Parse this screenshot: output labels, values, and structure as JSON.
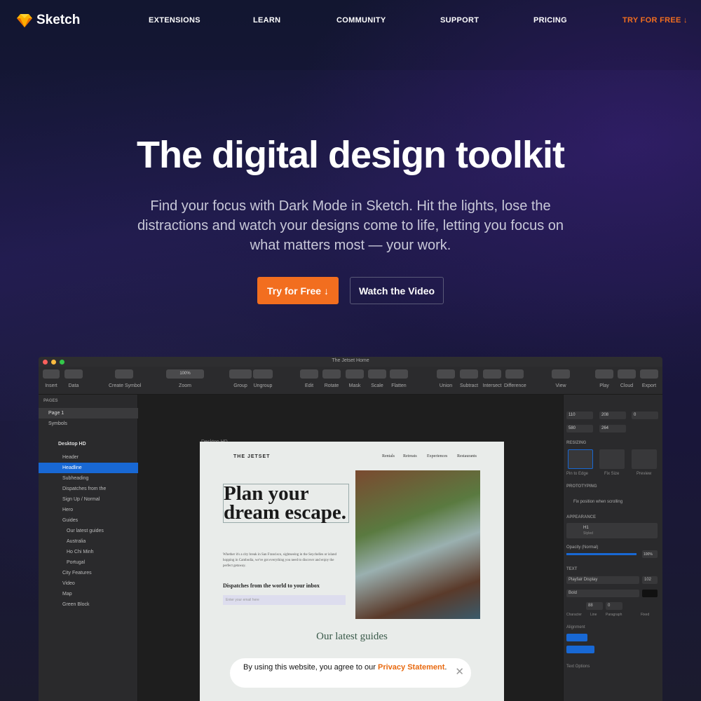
{
  "brand": {
    "name": "Sketch",
    "accent": "#f26e1f"
  },
  "nav": {
    "items": [
      "EXTENSIONS",
      "LEARN",
      "COMMUNITY",
      "SUPPORT",
      "PRICING"
    ],
    "cta": "TRY FOR FREE ↓"
  },
  "hero": {
    "title": "The digital design toolkit",
    "subtitle": "Find your focus with Dark Mode in Sketch. Hit the lights, lose the distractions and watch your designs come to life, letting you focus on what matters most — your work.",
    "primary_button": "Try for Free ↓",
    "secondary_button": "Watch the Video"
  },
  "app": {
    "window_title": "The Jetset Home",
    "toolbar": [
      "Insert",
      "Data",
      "Create Symbol",
      "Zoom",
      "Group",
      "Ungroup",
      "Edit",
      "Rotate",
      "Mask",
      "Scale",
      "Flatten",
      "Union",
      "Subtract",
      "Intersect",
      "Difference",
      "View",
      "Play",
      "Cloud",
      "Export"
    ],
    "zoom": "100%",
    "pages_header": "PAGES",
    "pages": [
      "Page 1",
      "Symbols"
    ],
    "layers_artboard": "Desktop HD",
    "layers": [
      "Header",
      "Headline",
      "Subheading",
      "Dispatches from the",
      "Sign Up / Normal",
      "Hero",
      "Guides",
      "Our latest guides",
      "Australia",
      "Ho Chi Minh",
      "Portugal",
      "City Features",
      "Video",
      "Map",
      "Green Block"
    ],
    "artboard_label": "Desktop HD",
    "inspector": {
      "x": "110",
      "y": "208",
      "rotate": "0",
      "w": "580",
      "h": "264",
      "resizing": "RESIZING",
      "pin": "Pin to Edge",
      "fix": "Fix Size",
      "preview": "Preview",
      "prototyping": "PROTOTYPING",
      "fix_scroll": "Fix position when scrolling",
      "appearance": "APPEARANCE",
      "style": "H1",
      "style_sub": "Styled",
      "opacity_label": "Opacity (Normal)",
      "opacity": "100%",
      "text": "TEXT",
      "font": "Playfair Display",
      "size": "102",
      "weight": "Bold",
      "char": "Character",
      "line": "Line",
      "para": "Paragraph",
      "line_val": "88",
      "para_val": "0",
      "fixed": "Fixed",
      "alignment": "Alignment",
      "text_options": "Text Options"
    }
  },
  "artboard": {
    "brand": "THE JETSET",
    "nav": [
      "Rentals",
      "Retreats",
      "Experiences",
      "Restaurants"
    ],
    "headline": "Plan your dream escape.",
    "body": "Whether it's a city break in San Francisco, sightseeing in the Seychelles or island hopping in Cambodia, we've got everything you need to discover and enjoy the perfect getaway.",
    "dispatch": "Dispatches from the world to your inbox",
    "email_placeholder": "Enter your email here",
    "guides": "Our latest guides"
  },
  "cookie": {
    "text": "By using this website, you agree to our ",
    "link": "Privacy Statement",
    "end": "."
  }
}
